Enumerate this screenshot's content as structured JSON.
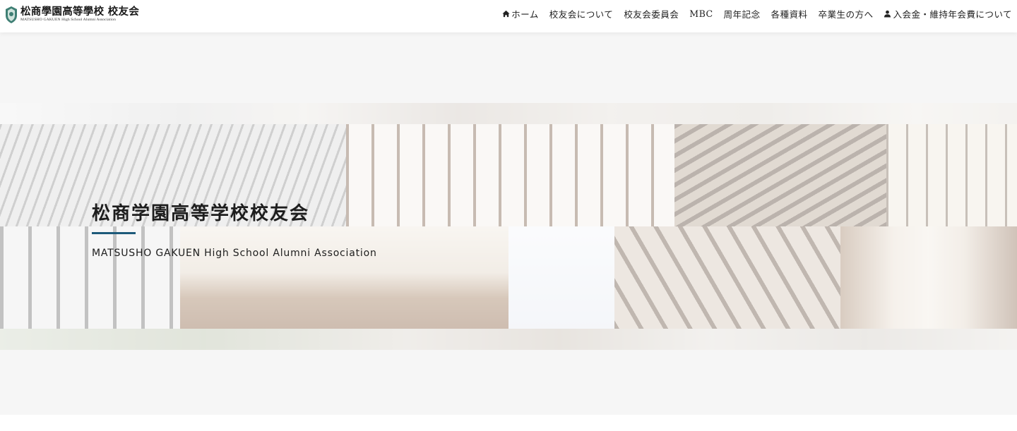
{
  "site": {
    "logo_title": "松商學園高等學校 校友会",
    "logo_subtitle": "MATSUSHO GAKUEN High School Alumni Association"
  },
  "nav": {
    "items": [
      {
        "label": "ホーム",
        "icon": "home-icon"
      },
      {
        "label": "校友会について"
      },
      {
        "label": "校友会委員会"
      },
      {
        "label": "MBC"
      },
      {
        "label": "周年記念"
      },
      {
        "label": "各種資料"
      },
      {
        "label": "卒業生の方へ"
      },
      {
        "label": "入会金・維持年会費について",
        "icon": "user-icon"
      }
    ]
  },
  "hero": {
    "title": "松商学園高等学校校友会",
    "subtitle": "MATSUSHO GAKUEN High School Alumni Association"
  },
  "colors": {
    "accent_line": "#1d5a7a",
    "header_bg": "#ffffff",
    "page_bg": "#f6f6f6"
  }
}
